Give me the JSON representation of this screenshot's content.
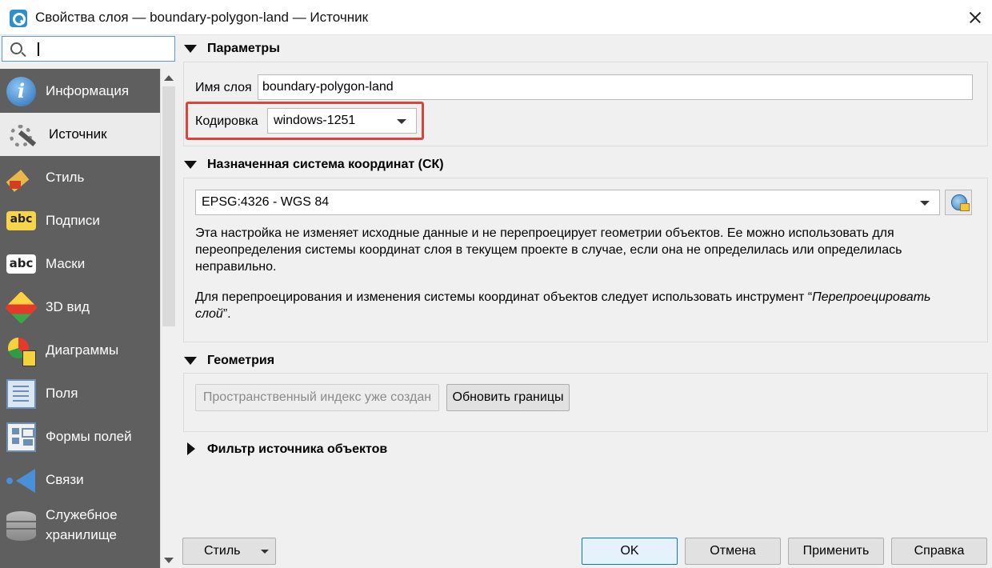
{
  "window": {
    "title": "Свойства слоя — boundary-polygon-land — Источник"
  },
  "search": {
    "value": ""
  },
  "sidebar": {
    "items": [
      {
        "label": "Информация",
        "icon": "info-icon"
      },
      {
        "label": "Источник",
        "icon": "source-icon",
        "active": true
      },
      {
        "label": "Стиль",
        "icon": "style-icon"
      },
      {
        "label": "Подписи",
        "icon": "labels-icon"
      },
      {
        "label": "Маски",
        "icon": "masks-icon"
      },
      {
        "label": "3D вид",
        "icon": "3d-view-icon"
      },
      {
        "label": "Диаграммы",
        "icon": "diagrams-icon"
      },
      {
        "label": "Поля",
        "icon": "fields-icon"
      },
      {
        "label": "Формы полей",
        "icon": "attribute-forms-icon"
      },
      {
        "label": "Связи",
        "icon": "joins-icon"
      },
      {
        "label": "Служебное хранилище",
        "icon": "auxiliary-storage-icon"
      }
    ]
  },
  "params": {
    "heading": "Параметры",
    "layer_name_label": "Имя слоя",
    "layer_name_value": "boundary-polygon-land",
    "encoding_label": "Кодировка",
    "encoding_value": "windows-1251"
  },
  "crs": {
    "heading": "Назначенная система координат (СК)",
    "value": "EPSG:4326 - WGS 84",
    "note1": "Эта настройка не изменяет исходные данные и не перепроецирует геометрии объектов. Ее можно использовать для переопределения системы координат слоя в текущем проекте в случае, если она не определилась или определилась неправильно.",
    "note2_prefix": "Для перепроецирования и изменения системы координат объектов следует использовать инструмент “",
    "note2_tool": "Перепроецировать слой",
    "note2_suffix": "”."
  },
  "geometry": {
    "heading": "Геометрия",
    "spatial_index_label": "Пространственный индекс уже создан",
    "update_extents_label": "Обновить границы"
  },
  "filter": {
    "heading": "Фильтр источника объектов"
  },
  "footer": {
    "style_label": "Стиль",
    "ok_label": "OK",
    "cancel_label": "Отмена",
    "apply_label": "Применить",
    "help_label": "Справка"
  },
  "colors": {
    "highlight": "#d9453a",
    "sidebar_bg": "#5f5f5f",
    "accent": "#0078d7"
  }
}
